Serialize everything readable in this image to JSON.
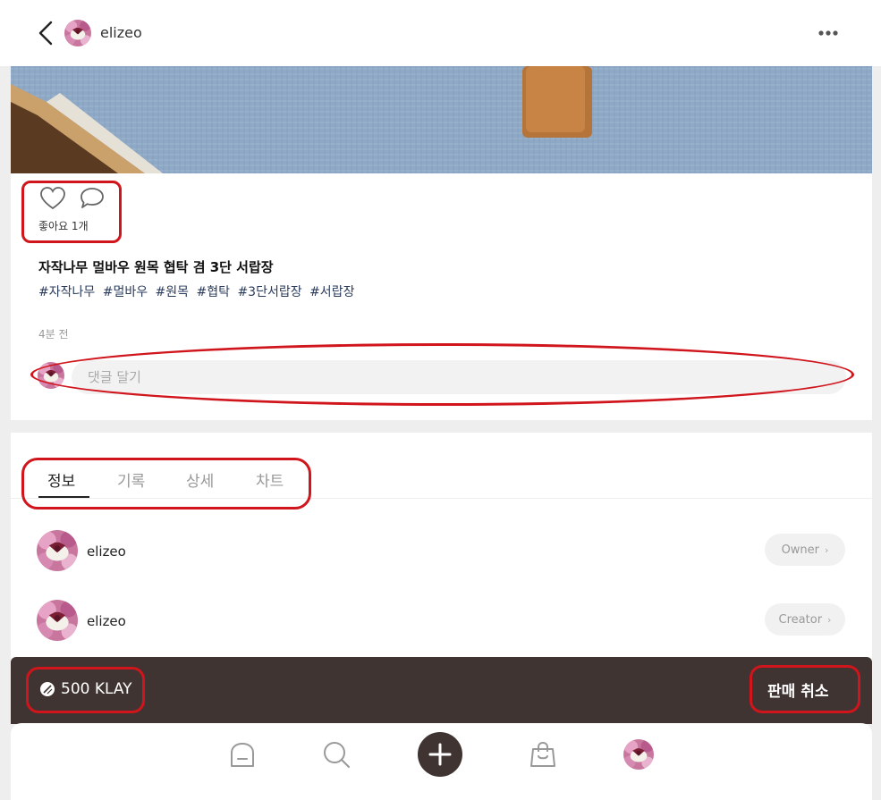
{
  "header": {
    "username": "elizeo",
    "back_icon": "chevron-left-icon",
    "more_icon": "more-horizontal-icon"
  },
  "post": {
    "likes_label": "좋아요 1개",
    "title": "자작나무 멀바우 원목 협탁 겸 3단 서랍장",
    "tags": [
      "#자작나무",
      "#멀바우",
      "#원목",
      "#협탁",
      "#3단서랍장",
      "#서랍장"
    ],
    "time": "4분 전",
    "comment_placeholder": "댓글 달기"
  },
  "tabs": [
    {
      "label": "정보",
      "active": true
    },
    {
      "label": "기록",
      "active": false
    },
    {
      "label": "상세",
      "active": false
    },
    {
      "label": "차트",
      "active": false
    }
  ],
  "people": [
    {
      "name": "elizeo",
      "role": "Owner"
    },
    {
      "name": "elizeo",
      "role": "Creator"
    }
  ],
  "price_bar": {
    "price": "500 KLAY",
    "cancel_label": "판매 취소"
  },
  "nav": {
    "items": [
      "home-icon",
      "search-icon",
      "add-icon",
      "bag-icon",
      "profile-avatar"
    ]
  },
  "colors": {
    "accent_dark": "#3f3431",
    "annotation_red": "#d0151c",
    "tag_blue": "#2a3b5c"
  }
}
